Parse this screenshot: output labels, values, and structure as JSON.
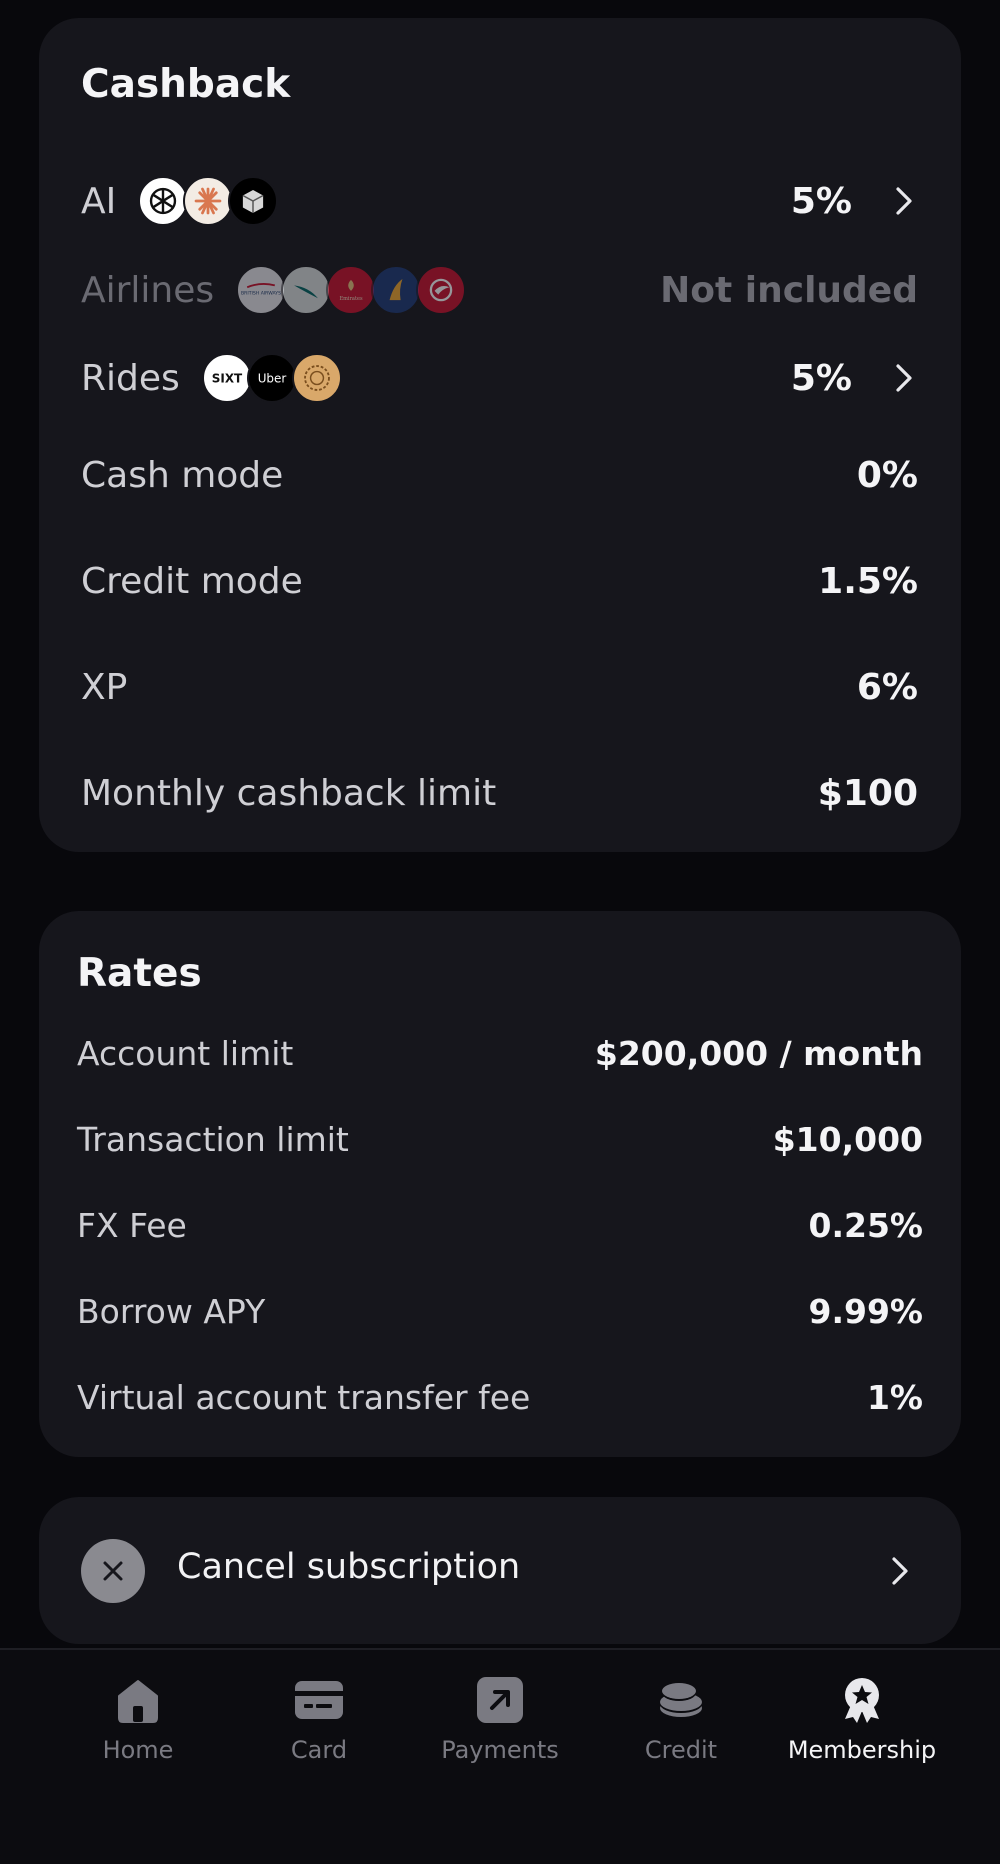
{
  "cashback": {
    "title": "Cashback",
    "rows": [
      {
        "label": "AI",
        "value": "5%",
        "logos": [
          "openai-logo",
          "anthropic-logo",
          "cube-logo"
        ]
      },
      {
        "label": "Airlines",
        "value": "Not included",
        "logos": [
          "british-airways-logo",
          "cathay-pacific-logo",
          "emirates-logo",
          "singapore-airlines-logo",
          "turkish-airlines-logo"
        ]
      },
      {
        "label": "Rides",
        "value": "5%",
        "logos": [
          "sixt-logo",
          "uber-logo",
          "gold-ring-logo"
        ]
      },
      {
        "label": "Cash mode",
        "value": "0%"
      },
      {
        "label": "Credit mode",
        "value": "1.5%"
      },
      {
        "label": "XP",
        "value": "6%"
      },
      {
        "label": "Monthly cashback limit",
        "value": "$100"
      }
    ],
    "logo_text": {
      "sixt": "SIXT",
      "uber": "Uber",
      "ba": "BRITISH AIRWAYS",
      "emirates": "Emirates"
    }
  },
  "rates": {
    "title": "Rates",
    "rows": [
      {
        "label": "Account limit",
        "value": "$200,000 / month"
      },
      {
        "label": "Transaction limit",
        "value": "$10,000"
      },
      {
        "label": "FX Fee",
        "value": "0.25%"
      },
      {
        "label": "Borrow APY",
        "value": "9.99%"
      },
      {
        "label": "Virtual account transfer fee",
        "value": "1%"
      }
    ]
  },
  "cancel": {
    "label": "Cancel subscription"
  },
  "tabbar": {
    "tabs": [
      {
        "label": "Home",
        "icon": "home-icon"
      },
      {
        "label": "Card",
        "icon": "card-icon"
      },
      {
        "label": "Payments",
        "icon": "payments-icon"
      },
      {
        "label": "Credit",
        "icon": "credit-icon"
      },
      {
        "label": "Membership",
        "icon": "membership-icon",
        "active": true
      }
    ]
  },
  "colors": {
    "background": "#08080c",
    "card": "#16161c",
    "text": "#f4f4f6",
    "muted": "#7a7a82"
  }
}
